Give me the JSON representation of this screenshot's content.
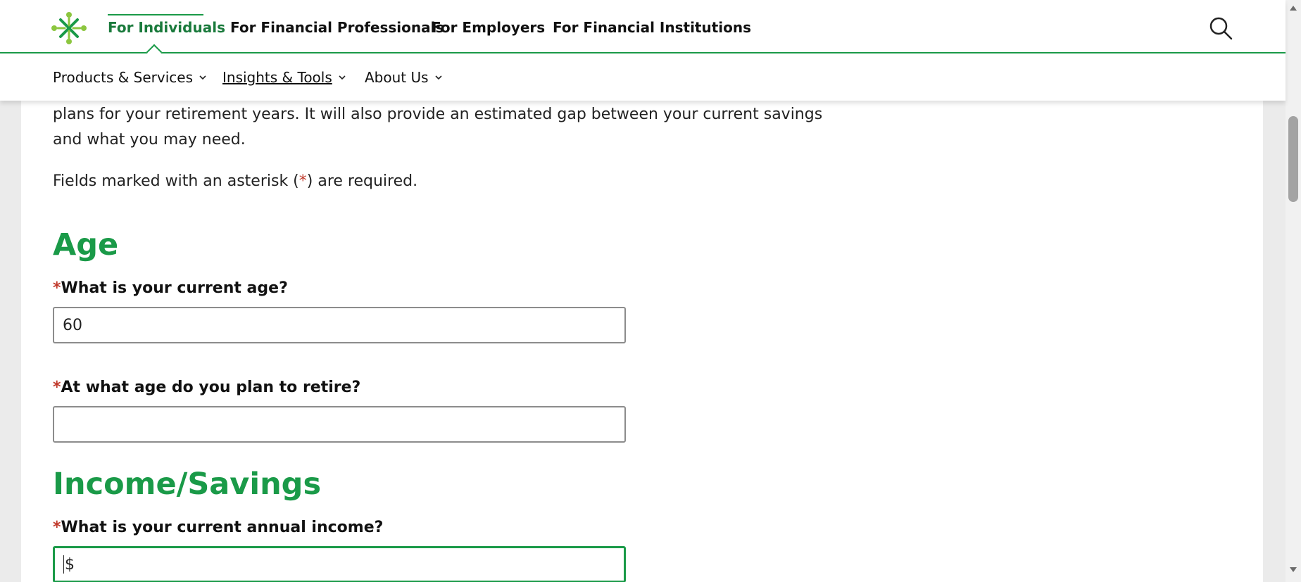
{
  "header": {
    "audience_tabs": [
      {
        "label": "For Individuals",
        "active": true
      },
      {
        "label": "For Financial Professionals",
        "active": false
      },
      {
        "label": "For Employers",
        "active": false
      },
      {
        "label": "For Financial Institutions",
        "active": false
      }
    ],
    "sub_nav": [
      {
        "label": "Products & Services",
        "icon": "chevron-down-icon"
      },
      {
        "label": "Insights & Tools",
        "icon": "chevron-down-icon",
        "underlined": true
      },
      {
        "label": "About Us",
        "icon": "chevron-down-icon"
      }
    ],
    "search_icon": "search-icon",
    "brand_color": "#1a9a48"
  },
  "main": {
    "intro_lines": [
      "plans for your retirement years. It will also provide an estimated gap between your current savings",
      "and what you may need."
    ],
    "required_note": {
      "before": "Fields marked with an asterisk (",
      "asterisk": "*",
      "after": ") are required."
    },
    "sections": [
      {
        "title": "Age",
        "fields": [
          {
            "label": "What is your current age?",
            "required": true,
            "value": "60"
          },
          {
            "label": "At what age do you plan to retire?",
            "required": true,
            "value": ""
          }
        ]
      },
      {
        "title": "Income/Savings",
        "fields": [
          {
            "label": "What is your current annual income?",
            "required": true,
            "value": "$",
            "focused": true
          }
        ]
      }
    ]
  },
  "colors": {
    "accent_green": "#1a9a48",
    "required_red": "#c0392b",
    "input_border": "#8c8c8c"
  }
}
